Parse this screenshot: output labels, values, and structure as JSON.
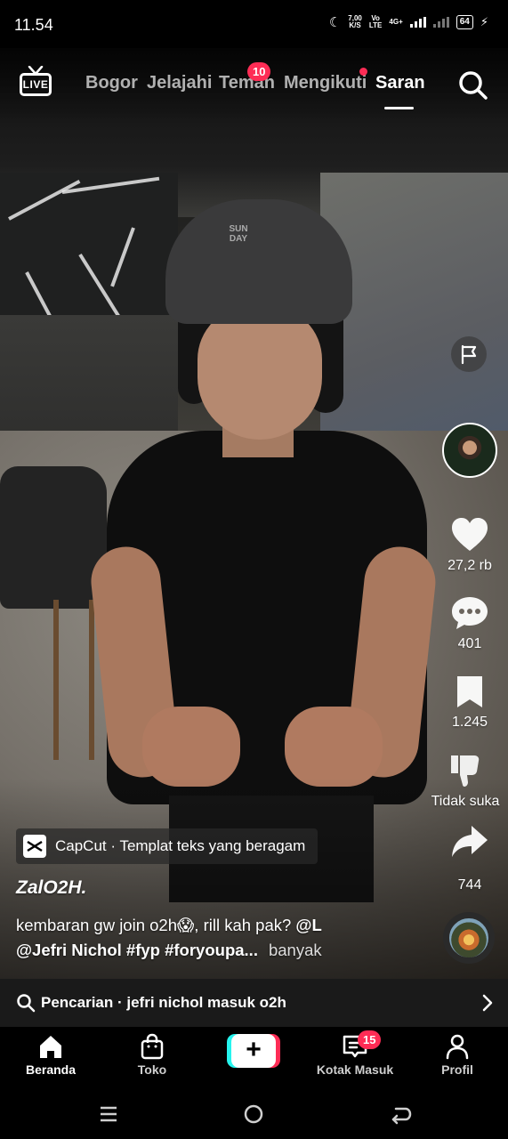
{
  "status_bar": {
    "time": "11.54",
    "net_speed_value": "7,00",
    "net_speed_unit": "K/S",
    "volte_top": "Vo",
    "volte_bottom": "LTE",
    "network_type": "4G+",
    "battery": "64"
  },
  "top_nav": {
    "tabs": [
      {
        "label": "Bogor",
        "active": false
      },
      {
        "label": "Jelajahi",
        "active": false
      },
      {
        "label": "Teman",
        "active": false
      },
      {
        "label": "Mengikuti",
        "active": false
      },
      {
        "label": "Saran",
        "active": true
      }
    ],
    "friends_badge": "10",
    "live_label": "LIVE",
    "icons": {
      "live": "live-tv-icon",
      "search": "search-icon"
    }
  },
  "rail": {
    "likes": "27,2 rb",
    "comments": "401",
    "bookmarks": "1.245",
    "dislike_label": "Tidak suka",
    "shares": "744",
    "icons": {
      "report": "flag-icon",
      "like": "heart-icon",
      "comment": "comment-icon",
      "bookmark": "bookmark-icon",
      "dislike": "thumbs-down-icon",
      "share": "share-arrow-icon"
    }
  },
  "post": {
    "capcut_text": "CapCut · Templat teks yang beragam",
    "username": "ZalO2H.",
    "caption_text": "kembaran gw join o2h😱, rill kah pak? ",
    "caption_mention1": "@L",
    "caption_line2": "@Jefri Nichol #fyp #foryoupa...",
    "more_label": "banyak",
    "hat_text": "SUN DAY"
  },
  "suggestion": {
    "text": "Pencarian · jefri nichol masuk o2h",
    "icons": {
      "search": "search-icon",
      "chevron": "chevron-right-icon"
    }
  },
  "bottom_nav": {
    "items": [
      {
        "label": "Beranda",
        "icon": "home-icon",
        "active": true
      },
      {
        "label": "Toko",
        "icon": "shopping-bag-icon",
        "active": false
      },
      {
        "label": "Kotak Masuk",
        "icon": "inbox-icon",
        "active": false
      },
      {
        "label": "Profil",
        "icon": "person-icon",
        "active": false
      }
    ],
    "create_label": "+",
    "inbox_badge": "15"
  },
  "system_nav": {
    "icons": [
      "recent-apps-icon",
      "home-circle-icon",
      "back-icon"
    ]
  },
  "colors": {
    "accent_red": "#fe2c55",
    "accent_cyan": "#25f4ee",
    "background": "#000000"
  }
}
